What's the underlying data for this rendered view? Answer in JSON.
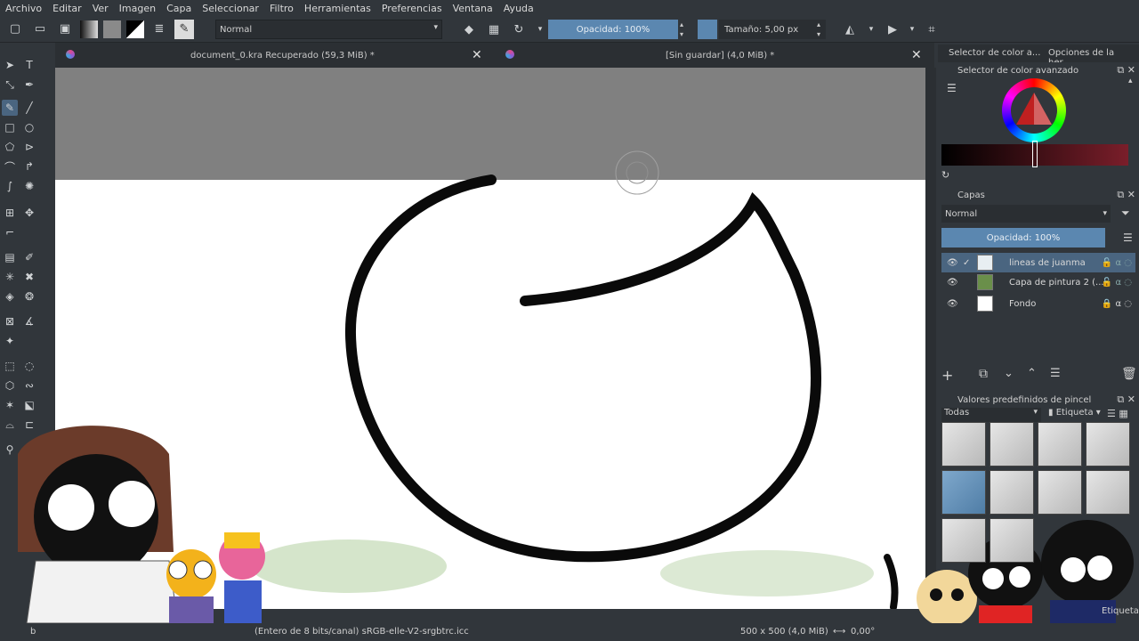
{
  "menubar": {
    "items": [
      "Archivo",
      "Editar",
      "Ver",
      "Imagen",
      "Capa",
      "Seleccionar",
      "Filtro",
      "Herramientas",
      "Preferencias",
      "Ventana",
      "Ayuda"
    ]
  },
  "tool_options": {
    "blend_mode": "Normal",
    "opacity": "Opacidad: 100%",
    "size": "Tamaño: 5,00 px"
  },
  "documents": [
    {
      "title": "document_0.kra Recuperado (59,3 MiB) *"
    },
    {
      "title": "[Sin guardar]  (4,0 MiB) *"
    }
  ],
  "status_bar": {
    "color_info": "(Entero de 8 bits/canal)  sRGB-elle-V2-srgbtrc.icc",
    "dimensions": "500 x 500 (4,0 MiB)",
    "rotation": "0,00°"
  },
  "dockers": {
    "tabs": [
      "Selector de color a...",
      "Opciones de la her..."
    ],
    "color_selector": {
      "title": "Selector de color avanzado"
    },
    "layers": {
      "title": "Capas",
      "blend_mode": "Normal",
      "opacity": "Opacidad:  100%",
      "items": [
        {
          "name": "lineas de juanma",
          "selected": true
        },
        {
          "name": "Capa de pintura 2 (...",
          "selected": false
        },
        {
          "name": "Fondo",
          "selected": false
        }
      ]
    },
    "brush_presets": {
      "title": "Valores predefinidos de pincel",
      "filter": "Todas",
      "tag_button": "Etiqueta",
      "footer_tag": "Etiqueta"
    }
  },
  "colors": {
    "accent": "#5b87b0",
    "selection": "#4a6580",
    "panel_bg": "#31363b",
    "canvas_bg": "#808080"
  }
}
